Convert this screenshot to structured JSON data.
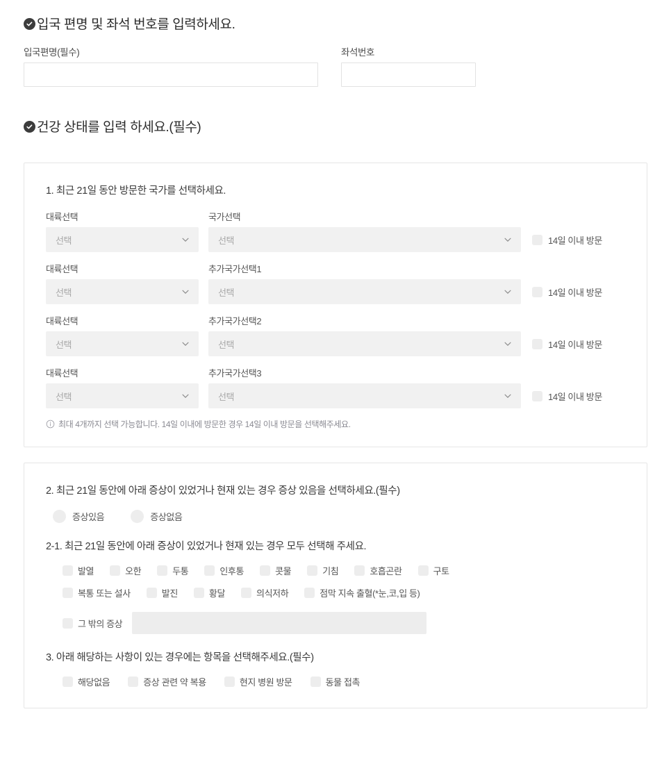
{
  "sections": {
    "flight": {
      "heading": "입국 편명 및 좌석 번호를 입력하세요.",
      "icon": "check-circle-icon",
      "flight_number": {
        "label": "입국편명(필수)",
        "value": "",
        "placeholder": ""
      },
      "seat_number": {
        "label": "좌석번호",
        "value": "",
        "placeholder": ""
      }
    },
    "health": {
      "heading": "건강 상태를 입력 하세요.(필수)",
      "icon": "check-circle-icon"
    }
  },
  "question1": {
    "title": "1. 최근 21일 동안 방문한 국가를 선택하세요.",
    "continent_label": "대륙선택",
    "select_placeholder": "선택",
    "within14_label": "14일 이내 방문",
    "rows": [
      {
        "country_label": "국가선택",
        "continent_value": "선택",
        "country_value": "선택",
        "within14_checked": false
      },
      {
        "country_label": "추가국가선택1",
        "continent_value": "선택",
        "country_value": "선택",
        "within14_checked": false
      },
      {
        "country_label": "추가국가선택2",
        "continent_value": "선택",
        "country_value": "선택",
        "within14_checked": false
      },
      {
        "country_label": "추가국가선택3",
        "continent_value": "선택",
        "country_value": "선택",
        "within14_checked": false
      }
    ],
    "note": "최대 4개까지 선택 가능합니다. 14일 이내에 방문한 경우 14일 이내 방문을 선택해주세요.",
    "note_icon": "info-icon"
  },
  "question2": {
    "title": "2. 최근 21일 동안에 아래 증상이 있었거나 현재 있는 경우 증상 있음을 선택하세요.(필수)",
    "options": [
      {
        "label": "증상있음",
        "selected": false
      },
      {
        "label": "증상없음",
        "selected": false
      }
    ]
  },
  "question2_1": {
    "title": "2-1. 최근 21일 동안에 아래 증상이 있었거나 현재 있는 경우 모두 선택해 주세요.",
    "row1": [
      {
        "label": "발열",
        "checked": false
      },
      {
        "label": "오한",
        "checked": false
      },
      {
        "label": "두통",
        "checked": false
      },
      {
        "label": "인후통",
        "checked": false
      },
      {
        "label": "콧물",
        "checked": false
      },
      {
        "label": "기침",
        "checked": false
      },
      {
        "label": "호흡곤란",
        "checked": false
      },
      {
        "label": "구토",
        "checked": false
      }
    ],
    "row2": [
      {
        "label": "복통 또는 설사",
        "checked": false
      },
      {
        "label": "발진",
        "checked": false
      },
      {
        "label": "황달",
        "checked": false
      },
      {
        "label": "의식저하",
        "checked": false
      },
      {
        "label": "점막 지속 출혈(*눈,코,입 등)",
        "checked": false
      }
    ],
    "other": {
      "label": "그 밖의 증상",
      "checked": false,
      "value": "",
      "placeholder": ""
    }
  },
  "question3": {
    "title": "3. 아래 해당하는 사항이 있는 경우에는 항목을 선택해주세요.(필수)",
    "options": [
      {
        "label": "해당없음",
        "checked": false
      },
      {
        "label": "증상 관련 약 복용",
        "checked": false
      },
      {
        "label": "현지 병원 방문",
        "checked": false
      },
      {
        "label": "동물 접촉",
        "checked": false
      }
    ]
  },
  "colors": {
    "badge": "#3c3c3c",
    "control_fill": "#ededed",
    "select_fill": "#f1f1f1",
    "card_border": "#e6e6e6",
    "note_text": "#8b8b93"
  }
}
